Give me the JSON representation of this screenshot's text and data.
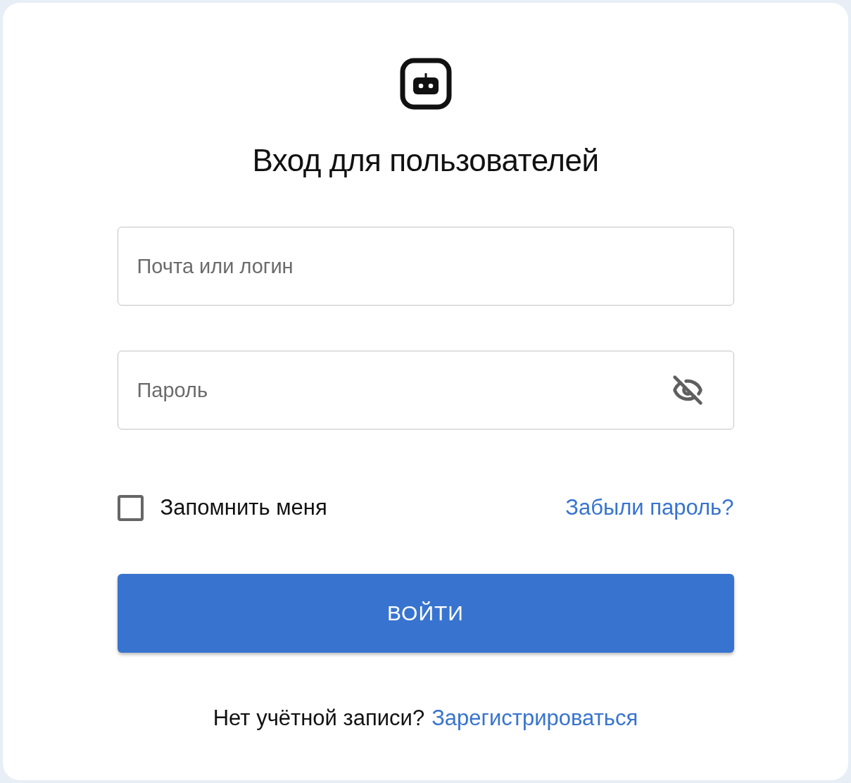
{
  "title": "Вход для пользователей",
  "login_field": {
    "placeholder": "Почта или логин"
  },
  "password_field": {
    "placeholder": "Пароль",
    "visible": false
  },
  "remember": {
    "label": "Запомнить меня",
    "checked": false
  },
  "forgot_link": "Забыли пароль?",
  "submit_button": "ВОЙТИ",
  "signup": {
    "text": "Нет учётной записи?",
    "link": "Зарегистрироваться"
  }
}
